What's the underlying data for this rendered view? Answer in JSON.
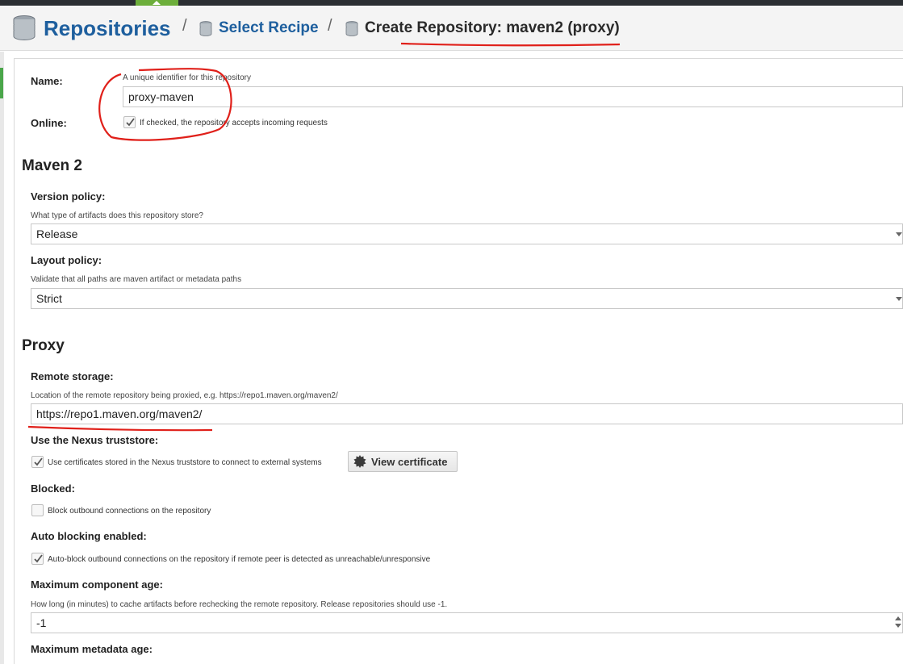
{
  "breadcrumb": {
    "root": "Repositories",
    "separator": "/",
    "step2": "Select Recipe",
    "step3": "Create Repository: maven2 (proxy)"
  },
  "icons": {
    "breadcrumb_root": "database-icon",
    "breadcrumb_step": "database-icon",
    "certificate": "gear-seal-icon",
    "checkbox": "checkmark-icon"
  },
  "colors": {
    "link": "#1e5f9e",
    "annotation": "#e0201a",
    "active_tab": "#6cae3b"
  },
  "form": {
    "name": {
      "label": "Name:",
      "help": "A unique identifier for this repository",
      "value": "proxy-maven"
    },
    "online": {
      "label": "Online:",
      "checked": true,
      "text": "If checked, the repository accepts incoming requests"
    },
    "maven2": {
      "title": "Maven 2",
      "version_policy": {
        "label": "Version policy:",
        "help": "What type of artifacts does this repository store?",
        "value": "Release"
      },
      "layout_policy": {
        "label": "Layout policy:",
        "help": "Validate that all paths are maven artifact or metadata paths",
        "value": "Strict"
      }
    },
    "proxy": {
      "title": "Proxy",
      "remote_storage": {
        "label": "Remote storage:",
        "help": "Location of the remote repository being proxied, e.g. https://repo1.maven.org/maven2/",
        "value": "https://repo1.maven.org/maven2/"
      },
      "truststore": {
        "label": "Use the Nexus truststore:",
        "checked": true,
        "text": "Use certificates stored in the Nexus truststore to connect to external systems",
        "button": "View certificate"
      },
      "blocked": {
        "label": "Blocked:",
        "checked": false,
        "text": "Block outbound connections on the repository"
      },
      "auto_blocking": {
        "label": "Auto blocking enabled:",
        "checked": true,
        "text": "Auto-block outbound connections on the repository if remote peer is detected as unreachable/unresponsive"
      },
      "max_component_age": {
        "label": "Maximum component age:",
        "help": "How long (in minutes) to cache artifacts before rechecking the remote repository. Release repositories should use -1.",
        "value": "-1"
      },
      "max_metadata_age": {
        "label": "Maximum metadata age:"
      }
    }
  }
}
